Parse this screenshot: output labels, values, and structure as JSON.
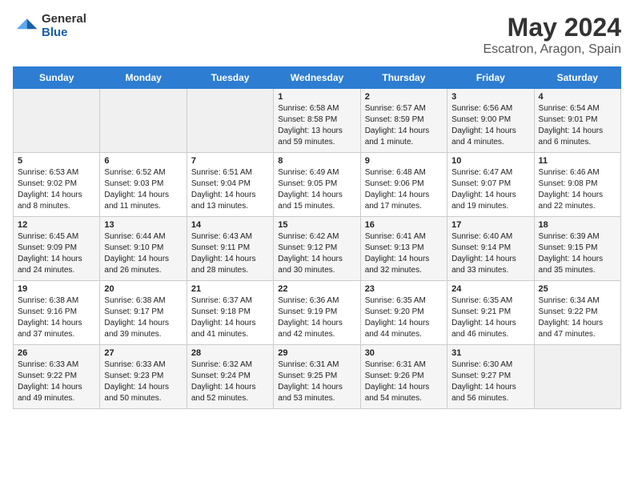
{
  "logo": {
    "general": "General",
    "blue": "Blue"
  },
  "title": "May 2024",
  "subtitle": "Escatron, Aragon, Spain",
  "headers": [
    "Sunday",
    "Monday",
    "Tuesday",
    "Wednesday",
    "Thursday",
    "Friday",
    "Saturday"
  ],
  "weeks": [
    [
      {
        "day": "",
        "sunrise": "",
        "sunset": "",
        "daylight": ""
      },
      {
        "day": "",
        "sunrise": "",
        "sunset": "",
        "daylight": ""
      },
      {
        "day": "",
        "sunrise": "",
        "sunset": "",
        "daylight": ""
      },
      {
        "day": "1",
        "sunrise": "Sunrise: 6:58 AM",
        "sunset": "Sunset: 8:58 PM",
        "daylight": "Daylight: 13 hours and 59 minutes."
      },
      {
        "day": "2",
        "sunrise": "Sunrise: 6:57 AM",
        "sunset": "Sunset: 8:59 PM",
        "daylight": "Daylight: 14 hours and 1 minute."
      },
      {
        "day": "3",
        "sunrise": "Sunrise: 6:56 AM",
        "sunset": "Sunset: 9:00 PM",
        "daylight": "Daylight: 14 hours and 4 minutes."
      },
      {
        "day": "4",
        "sunrise": "Sunrise: 6:54 AM",
        "sunset": "Sunset: 9:01 PM",
        "daylight": "Daylight: 14 hours and 6 minutes."
      }
    ],
    [
      {
        "day": "5",
        "sunrise": "Sunrise: 6:53 AM",
        "sunset": "Sunset: 9:02 PM",
        "daylight": "Daylight: 14 hours and 8 minutes."
      },
      {
        "day": "6",
        "sunrise": "Sunrise: 6:52 AM",
        "sunset": "Sunset: 9:03 PM",
        "daylight": "Daylight: 14 hours and 11 minutes."
      },
      {
        "day": "7",
        "sunrise": "Sunrise: 6:51 AM",
        "sunset": "Sunset: 9:04 PM",
        "daylight": "Daylight: 14 hours and 13 minutes."
      },
      {
        "day": "8",
        "sunrise": "Sunrise: 6:49 AM",
        "sunset": "Sunset: 9:05 PM",
        "daylight": "Daylight: 14 hours and 15 minutes."
      },
      {
        "day": "9",
        "sunrise": "Sunrise: 6:48 AM",
        "sunset": "Sunset: 9:06 PM",
        "daylight": "Daylight: 14 hours and 17 minutes."
      },
      {
        "day": "10",
        "sunrise": "Sunrise: 6:47 AM",
        "sunset": "Sunset: 9:07 PM",
        "daylight": "Daylight: 14 hours and 19 minutes."
      },
      {
        "day": "11",
        "sunrise": "Sunrise: 6:46 AM",
        "sunset": "Sunset: 9:08 PM",
        "daylight": "Daylight: 14 hours and 22 minutes."
      }
    ],
    [
      {
        "day": "12",
        "sunrise": "Sunrise: 6:45 AM",
        "sunset": "Sunset: 9:09 PM",
        "daylight": "Daylight: 14 hours and 24 minutes."
      },
      {
        "day": "13",
        "sunrise": "Sunrise: 6:44 AM",
        "sunset": "Sunset: 9:10 PM",
        "daylight": "Daylight: 14 hours and 26 minutes."
      },
      {
        "day": "14",
        "sunrise": "Sunrise: 6:43 AM",
        "sunset": "Sunset: 9:11 PM",
        "daylight": "Daylight: 14 hours and 28 minutes."
      },
      {
        "day": "15",
        "sunrise": "Sunrise: 6:42 AM",
        "sunset": "Sunset: 9:12 PM",
        "daylight": "Daylight: 14 hours and 30 minutes."
      },
      {
        "day": "16",
        "sunrise": "Sunrise: 6:41 AM",
        "sunset": "Sunset: 9:13 PM",
        "daylight": "Daylight: 14 hours and 32 minutes."
      },
      {
        "day": "17",
        "sunrise": "Sunrise: 6:40 AM",
        "sunset": "Sunset: 9:14 PM",
        "daylight": "Daylight: 14 hours and 33 minutes."
      },
      {
        "day": "18",
        "sunrise": "Sunrise: 6:39 AM",
        "sunset": "Sunset: 9:15 PM",
        "daylight": "Daylight: 14 hours and 35 minutes."
      }
    ],
    [
      {
        "day": "19",
        "sunrise": "Sunrise: 6:38 AM",
        "sunset": "Sunset: 9:16 PM",
        "daylight": "Daylight: 14 hours and 37 minutes."
      },
      {
        "day": "20",
        "sunrise": "Sunrise: 6:38 AM",
        "sunset": "Sunset: 9:17 PM",
        "daylight": "Daylight: 14 hours and 39 minutes."
      },
      {
        "day": "21",
        "sunrise": "Sunrise: 6:37 AM",
        "sunset": "Sunset: 9:18 PM",
        "daylight": "Daylight: 14 hours and 41 minutes."
      },
      {
        "day": "22",
        "sunrise": "Sunrise: 6:36 AM",
        "sunset": "Sunset: 9:19 PM",
        "daylight": "Daylight: 14 hours and 42 minutes."
      },
      {
        "day": "23",
        "sunrise": "Sunrise: 6:35 AM",
        "sunset": "Sunset: 9:20 PM",
        "daylight": "Daylight: 14 hours and 44 minutes."
      },
      {
        "day": "24",
        "sunrise": "Sunrise: 6:35 AM",
        "sunset": "Sunset: 9:21 PM",
        "daylight": "Daylight: 14 hours and 46 minutes."
      },
      {
        "day": "25",
        "sunrise": "Sunrise: 6:34 AM",
        "sunset": "Sunset: 9:22 PM",
        "daylight": "Daylight: 14 hours and 47 minutes."
      }
    ],
    [
      {
        "day": "26",
        "sunrise": "Sunrise: 6:33 AM",
        "sunset": "Sunset: 9:22 PM",
        "daylight": "Daylight: 14 hours and 49 minutes."
      },
      {
        "day": "27",
        "sunrise": "Sunrise: 6:33 AM",
        "sunset": "Sunset: 9:23 PM",
        "daylight": "Daylight: 14 hours and 50 minutes."
      },
      {
        "day": "28",
        "sunrise": "Sunrise: 6:32 AM",
        "sunset": "Sunset: 9:24 PM",
        "daylight": "Daylight: 14 hours and 52 minutes."
      },
      {
        "day": "29",
        "sunrise": "Sunrise: 6:31 AM",
        "sunset": "Sunset: 9:25 PM",
        "daylight": "Daylight: 14 hours and 53 minutes."
      },
      {
        "day": "30",
        "sunrise": "Sunrise: 6:31 AM",
        "sunset": "Sunset: 9:26 PM",
        "daylight": "Daylight: 14 hours and 54 minutes."
      },
      {
        "day": "31",
        "sunrise": "Sunrise: 6:30 AM",
        "sunset": "Sunset: 9:27 PM",
        "daylight": "Daylight: 14 hours and 56 minutes."
      },
      {
        "day": "",
        "sunrise": "",
        "sunset": "",
        "daylight": ""
      }
    ]
  ]
}
